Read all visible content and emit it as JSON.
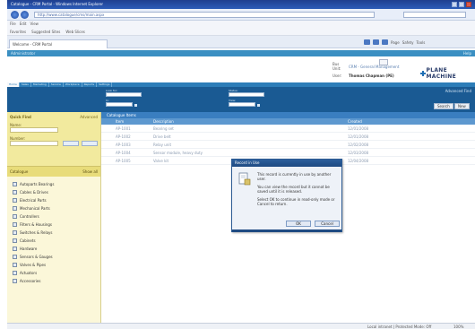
{
  "browser": {
    "title": "Catalogue - CRM Portal - Windows Internet Explorer",
    "url": "http://www.catalogue/cms/main.aspx",
    "menu": [
      "File",
      "Edit",
      "View"
    ],
    "favorites": [
      "Favorites",
      "Suggested Sites",
      "Web Slices"
    ],
    "tab_label": "Welcome - CRM Portal",
    "commands": [
      "Page",
      "Safety",
      "Tools"
    ]
  },
  "app": {
    "strip_title": "Administrator",
    "strip_right": "Help",
    "context": {
      "bu_label": "Bus Unit:",
      "bu_value": "CRM - General Management",
      "user_label": "User:",
      "user_value": "Thomas Chapman (PE)"
    },
    "logo_text": "PLANE MACHINE"
  },
  "nav_tabs": [
    "Home",
    "Sales",
    "Marketing",
    "Service",
    "Workplace",
    "Reports",
    "Settings"
  ],
  "filter": {
    "label_1": "Look for:",
    "label_2": "In:",
    "label_3": "Status:",
    "label_4": "View:",
    "link": "Advanced Find",
    "btn_search": "Search",
    "btn_new": "New"
  },
  "left_panel": {
    "title": "Quick Find",
    "link": "Advanced",
    "label_name": "Name:",
    "label_number": "Number:",
    "btn_go": "Go",
    "btn_clear": "Clear",
    "section": "Catalogue",
    "section_right": "Show all",
    "items": [
      "Autoparts Bearings",
      "Cables & Drives",
      "Electrical Parts",
      "Mechanical Parts",
      "Controllers",
      "Filters & Housings",
      "Switches & Relays",
      "Cabinets",
      "Hardware",
      "Sensors & Gauges",
      "Valves & Pipes",
      "Actuators",
      "Accessories"
    ]
  },
  "grid": {
    "header": "Catalogue Items",
    "columns": [
      "Item",
      "Description",
      "Created"
    ],
    "rows": [
      {
        "item": "AP-1001",
        "desc": "Bearing set",
        "date": "12/01/2008"
      },
      {
        "item": "AP-1002",
        "desc": "Drive belt",
        "date": "12/01/2008"
      },
      {
        "item": "AP-1003",
        "desc": "Relay unit",
        "date": "12/02/2008"
      },
      {
        "item": "AP-1004",
        "desc": "Sensor module, heavy duty",
        "date": "12/03/2008"
      },
      {
        "item": "AP-1005",
        "desc": "Valve kit",
        "date": "12/04/2008"
      }
    ]
  },
  "dialog": {
    "title": "Record in Use",
    "p1": "This record is currently in use by another user.",
    "p2": "You can view the record but it cannot be saved until it is released.",
    "p3": "Select OK to continue in read-only mode or Cancel to return.",
    "btn_ok": "OK",
    "btn_cancel": "Cancel"
  },
  "status": {
    "zone": "Local intranet | Protected Mode: Off",
    "zoom": "100%"
  },
  "colors": {
    "app_blue": "#1a5a93",
    "panel_yellow": "#fbf7d9",
    "dialog_border": "#2c5b94"
  }
}
